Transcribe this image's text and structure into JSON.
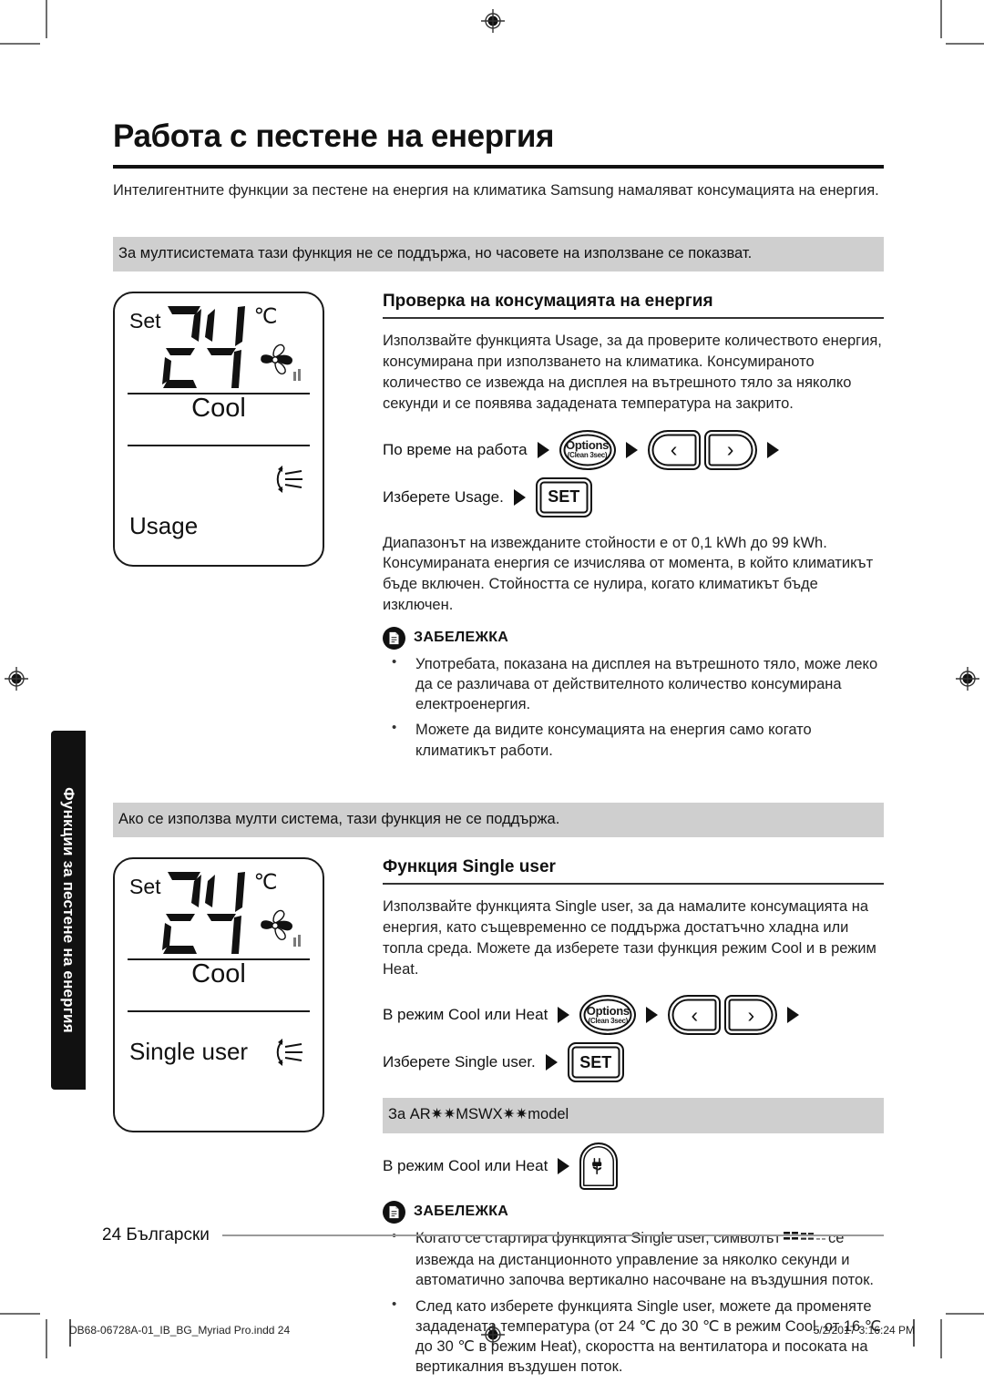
{
  "page": {
    "title": "Работа с пестене на енергия",
    "intro": "Интелигентните функции за пестене на енергия на климатика Samsung намаляват консумацията на енергия.",
    "side_tab": "Функции за пестене на енергия",
    "page_number": "24",
    "language": "Български"
  },
  "print_footer": {
    "file": "DB68-06728A-01_IB_BG_Myriad Pro.indd   24",
    "timestamp": "5/2/2017   3:16:24 PM"
  },
  "section_usage": {
    "banner": "За мултисистемата тази функция не се поддържа, но часовете на използване се показват.",
    "lcd": {
      "set_label": "Set",
      "temperature": "24",
      "unit": "℃",
      "mode": "Cool",
      "function": "Usage",
      "fan_icon": "fan-icon",
      "fan_speed_icon": "fan-speed-bars-icon",
      "swing_icon": "airflow-swing-icon"
    },
    "heading": "Проверка на консумацията на енергия",
    "paragraph": "Използвайте функцията Usage, за да проверите количеството енергия, консумирана при използването на климатика. Консумираното количество се извежда на дисплея на вътрешното тяло за няколко секунди и се появява зададената температура на закрито.",
    "step1_label": "По време на работа",
    "step2_label": "Изберете Usage.",
    "options_main": "Options",
    "options_sub": "(Clean 3sec)",
    "chevron_left": "‹",
    "chevron_right": "›",
    "set_button": "SET",
    "paragraph2": "Диапазонът на извежданите стойности е от 0,1 kWh до 99 kWh. Консумираната енергия се изчислява от момента, в който климатикът бъде включен. Стойността се нулира, когато климатикът бъде изключен.",
    "note_title": "ЗАБЕЛЕЖКА",
    "notes": [
      "Употребата, показана на дисплея на вътрешното тяло, може леко да се различава от действителното количество консумирана електроенергия.",
      "Можете да видите консумацията на енергия само когато климатикът работи."
    ]
  },
  "section_single_user": {
    "banner": "Ако се използва мулти система, тази функция не се поддържа.",
    "lcd": {
      "set_label": "Set",
      "temperature": "24",
      "unit": "℃",
      "mode": "Cool",
      "function": "Single user",
      "fan_icon": "fan-icon",
      "fan_speed_icon": "fan-speed-bars-icon",
      "swing_icon": "airflow-swing-icon"
    },
    "heading": "Функция Single user",
    "paragraph": "Използвайте функцията Single user, за да намалите консумацията на енергия, като същевременно се поддържа достатъчно хладна или топла среда. Можете да изберете тази функция режим Cool и в режим Heat.",
    "step1_label": "В режим Cool или Heat",
    "step2_label": "Изберете Single user.",
    "options_main": "Options",
    "options_sub": "(Clean 3sec)",
    "chevron_left": "‹",
    "chevron_right": "›",
    "set_button": "SET",
    "model_banner": "За AR✷✷MSWX✷✷model",
    "step3_label": "В режим Cool или Heat",
    "eco_button_icon": "eco-plug-leaf-icon",
    "note_title": "ЗАБЕЛЕЖКА",
    "note1_before": "Когато се стартира функцията Single user, символът",
    "note1_symbol": "fading-dashes-icon",
    "note1_after": "се извежда на дистанционното управление за няколко секунди и автоматично започва вертикално насочване на въздушния поток.",
    "note2": "След като изберете функцията Single user, можете да променяте зададената температура (от 24 ℃ до 30 ℃ в режим Cool, от 16 ℃ до 30 ℃ в режим Heat), скоростта на вентилатора и посоката на вертикалния въздушен поток."
  },
  "colors": {
    "ink": "#111111",
    "banner_gray": "#cfcfcf",
    "rule_gray": "#9a9a9a"
  }
}
